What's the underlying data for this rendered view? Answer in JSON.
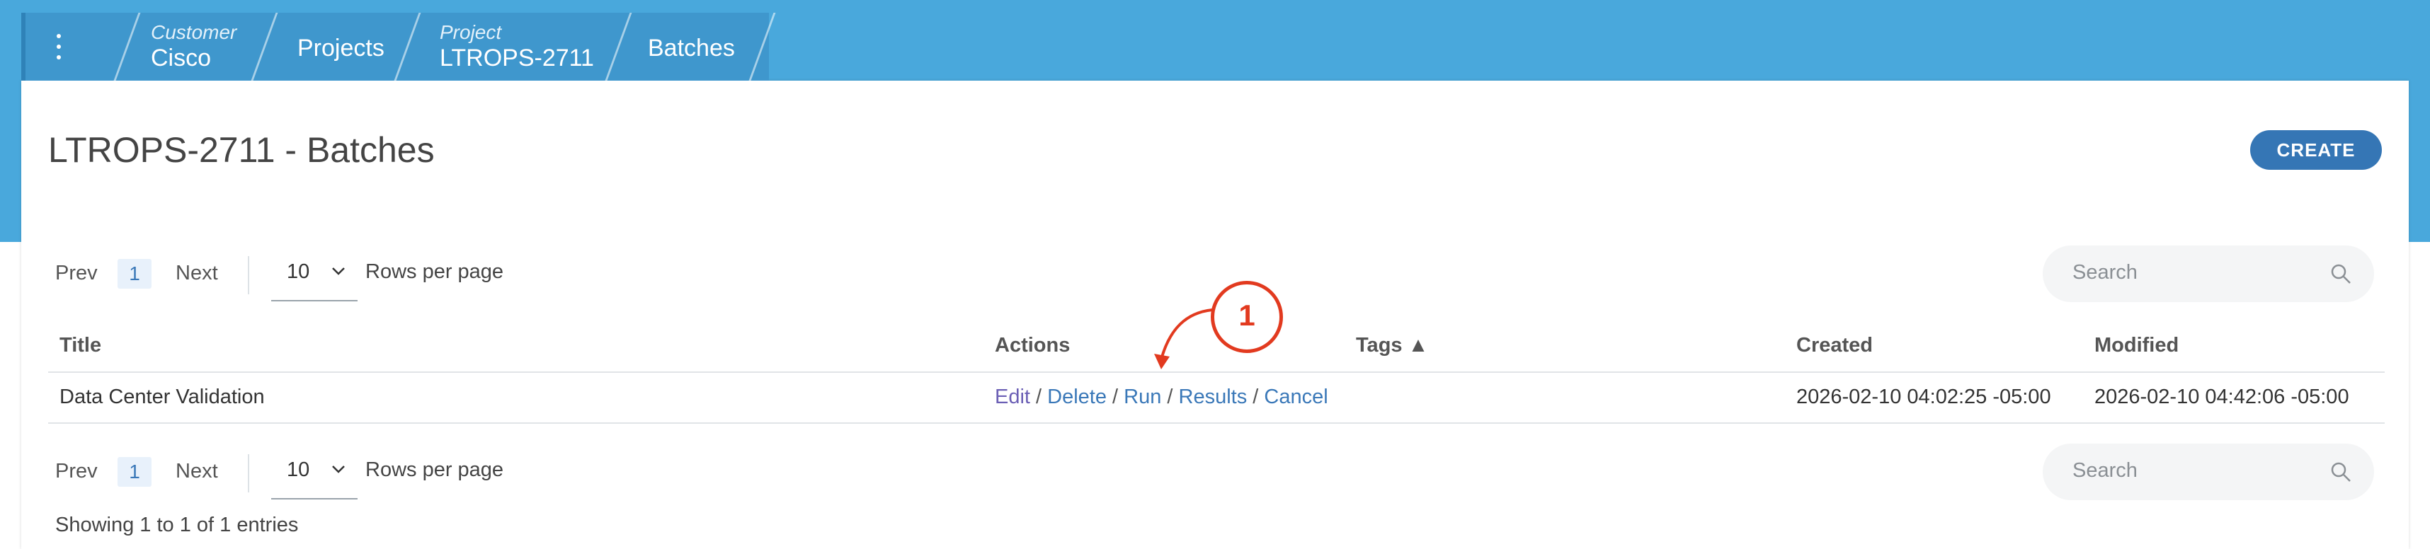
{
  "breadcrumb": {
    "items": [
      {
        "small": "Customer",
        "main": "Cisco"
      },
      {
        "small": "",
        "main": "Projects"
      },
      {
        "small": "Project",
        "main": "LTROPS-2711"
      },
      {
        "small": "",
        "main": "Batches"
      }
    ]
  },
  "page": {
    "title": "LTROPS-2711 - Batches",
    "create_label": "CREATE"
  },
  "pager_top": {
    "prev": "Prev",
    "page": "1",
    "next": "Next",
    "rows_value": "10",
    "rows_label": "Rows per page",
    "search_placeholder": "Search"
  },
  "pager_bottom": {
    "prev": "Prev",
    "page": "1",
    "next": "Next",
    "rows_value": "10",
    "rows_label": "Rows per page",
    "search_placeholder": "Search"
  },
  "table": {
    "columns": {
      "title": "Title",
      "actions": "Actions",
      "tags": "Tags ▲",
      "created": "Created",
      "modified": "Modified"
    },
    "rows": [
      {
        "title": "Data Center Validation",
        "actions": {
          "edit": "Edit",
          "delete": "Delete",
          "run": "Run",
          "results": "Results",
          "cancel": "Cancel",
          "separator": " / "
        },
        "tags": "",
        "created": "2026-02-10 04:02:25 -05:00",
        "modified": "2026-02-10 04:42:06 -05:00"
      }
    ]
  },
  "footer": {
    "showing": "Showing 1 to 1 of 1 entries"
  },
  "annotation": {
    "label": "1"
  },
  "colors": {
    "topbar": "#49a8dc",
    "accent": "#3576b5",
    "link": "#3a78b8",
    "annotation": "#e23a1f"
  },
  "icons": {
    "menu": "vertical-dots-icon",
    "search": "search-icon",
    "chevron": "chevron-down-icon"
  }
}
